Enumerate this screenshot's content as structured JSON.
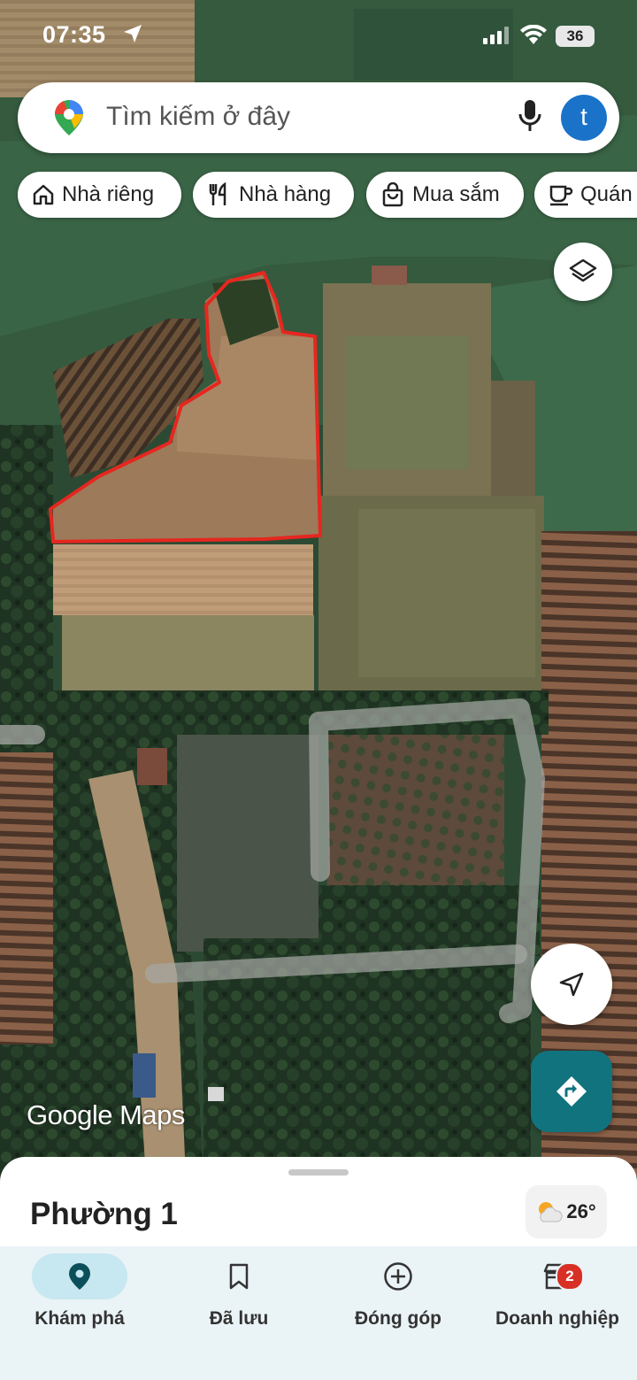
{
  "status_bar": {
    "time": "07:35",
    "battery": "36"
  },
  "search": {
    "placeholder": "Tìm kiếm ở đây",
    "avatar_letter": "t"
  },
  "chips": [
    {
      "label": "Nhà riêng",
      "icon": "home-icon"
    },
    {
      "label": "Nhà hàng",
      "icon": "restaurant-icon"
    },
    {
      "label": "Mua sắm",
      "icon": "shopping-bag-icon"
    },
    {
      "label": "Quán",
      "icon": "coffee-icon"
    }
  ],
  "map": {
    "attribution": "Google Maps",
    "outline_color": "#e5271f"
  },
  "sheet": {
    "place_name": "Phường 1",
    "temperature": "26°"
  },
  "bottom_nav": [
    {
      "label": "Khám phá",
      "icon": "location-pin-icon",
      "active": true
    },
    {
      "label": "Đã lưu",
      "icon": "bookmark-icon",
      "active": false
    },
    {
      "label": "Đóng góp",
      "icon": "add-circle-icon",
      "active": false
    },
    {
      "label": "Doanh nghiệp",
      "icon": "storefront-icon",
      "active": false,
      "badge": "2"
    }
  ],
  "colors": {
    "accent": "#10737e",
    "active_nav": "#c7e8f1",
    "avatar": "#1a73c9",
    "badge": "#d93025"
  }
}
